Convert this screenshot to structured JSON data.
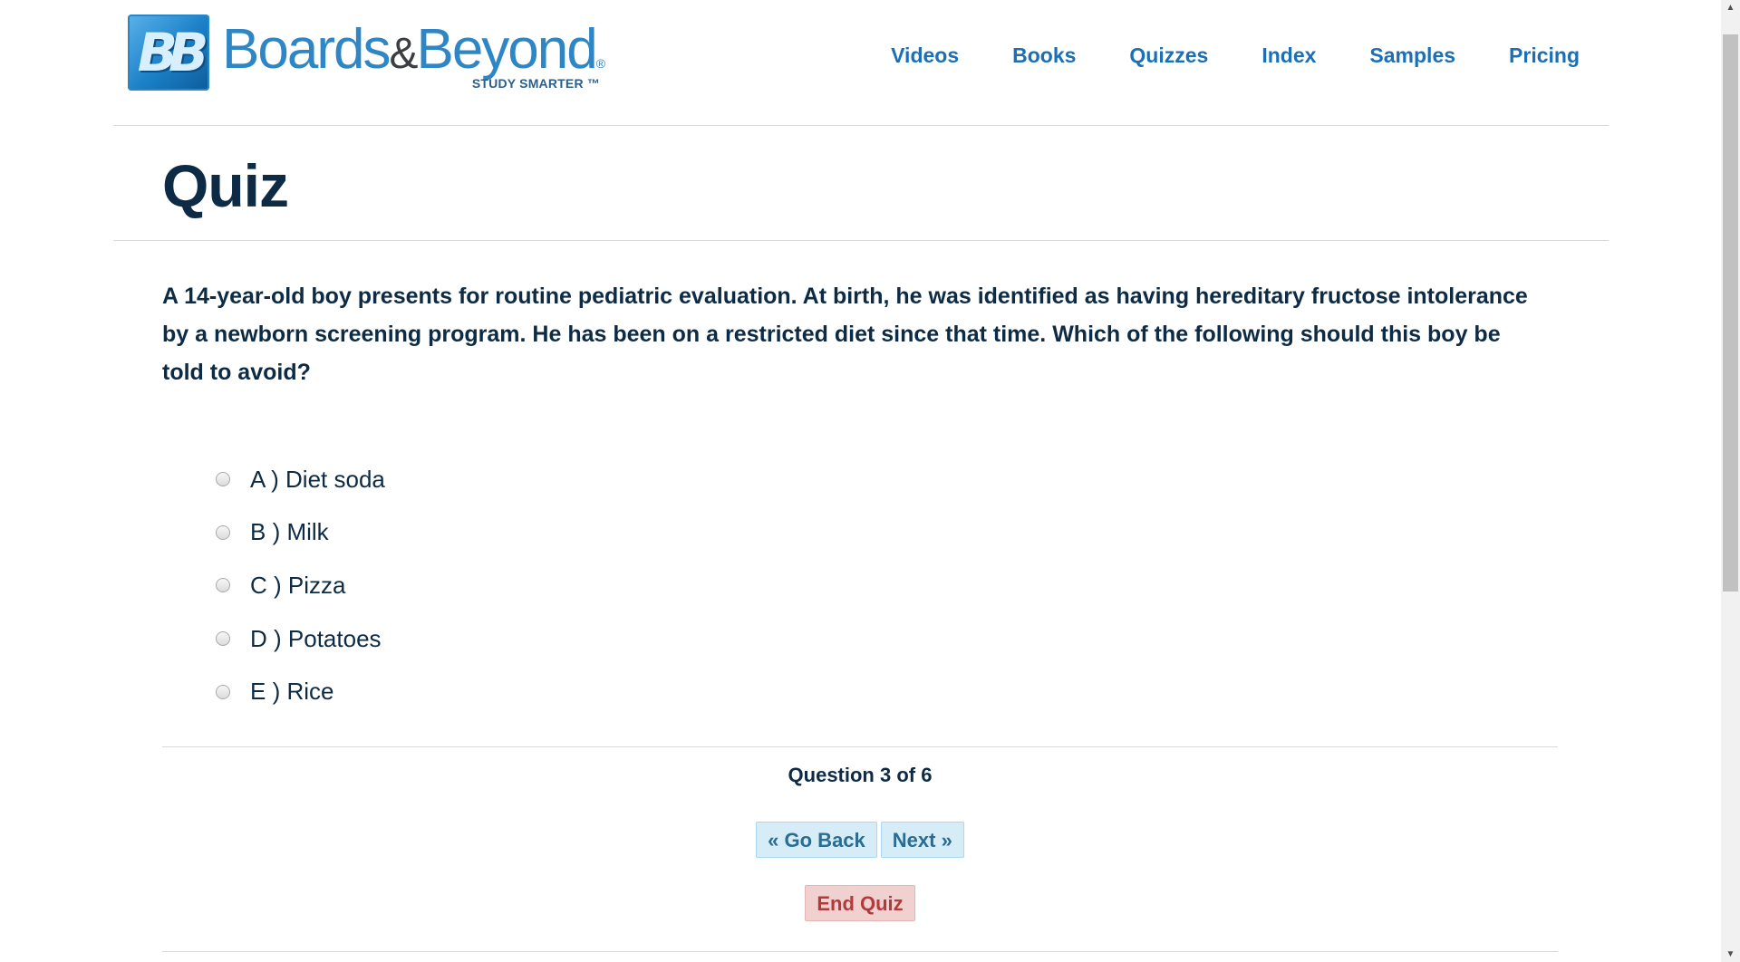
{
  "header": {
    "logo": {
      "mark": "BB",
      "word_1": "Boards",
      "amp": "&",
      "word_2": "Beyond",
      "registered": "®",
      "tagline": "STUDY SMARTER ™"
    },
    "nav": [
      {
        "label": "Videos"
      },
      {
        "label": "Books"
      },
      {
        "label": "Quizzes"
      },
      {
        "label": "Index"
      },
      {
        "label": "Samples"
      },
      {
        "label": "Pricing"
      }
    ]
  },
  "page": {
    "title": "Quiz"
  },
  "quiz": {
    "question": "A 14-year-old boy presents for routine pediatric evaluation. At birth, he was identified as having hereditary fructose intolerance by a newborn screening program. He has been on a restricted diet since that time. Which of the following should this boy be told to avoid?",
    "options": [
      {
        "letter": "A )",
        "text": "Diet soda"
      },
      {
        "letter": "B )",
        "text": "Milk"
      },
      {
        "letter": "C )",
        "text": "Pizza"
      },
      {
        "letter": "D )",
        "text": "Potatoes"
      },
      {
        "letter": "E )",
        "text": "Rice"
      }
    ],
    "counter": "Question 3 of 6",
    "buttons": {
      "back": "« Go Back",
      "next": "Next »",
      "end": "End Quiz"
    }
  },
  "colors": {
    "nav_link": "#1c6fb5",
    "heading": "#0d2b45",
    "info_button_bg": "#d6edf7",
    "danger_button_bg": "#f1d0d0",
    "danger_text": "#b33a3a"
  }
}
